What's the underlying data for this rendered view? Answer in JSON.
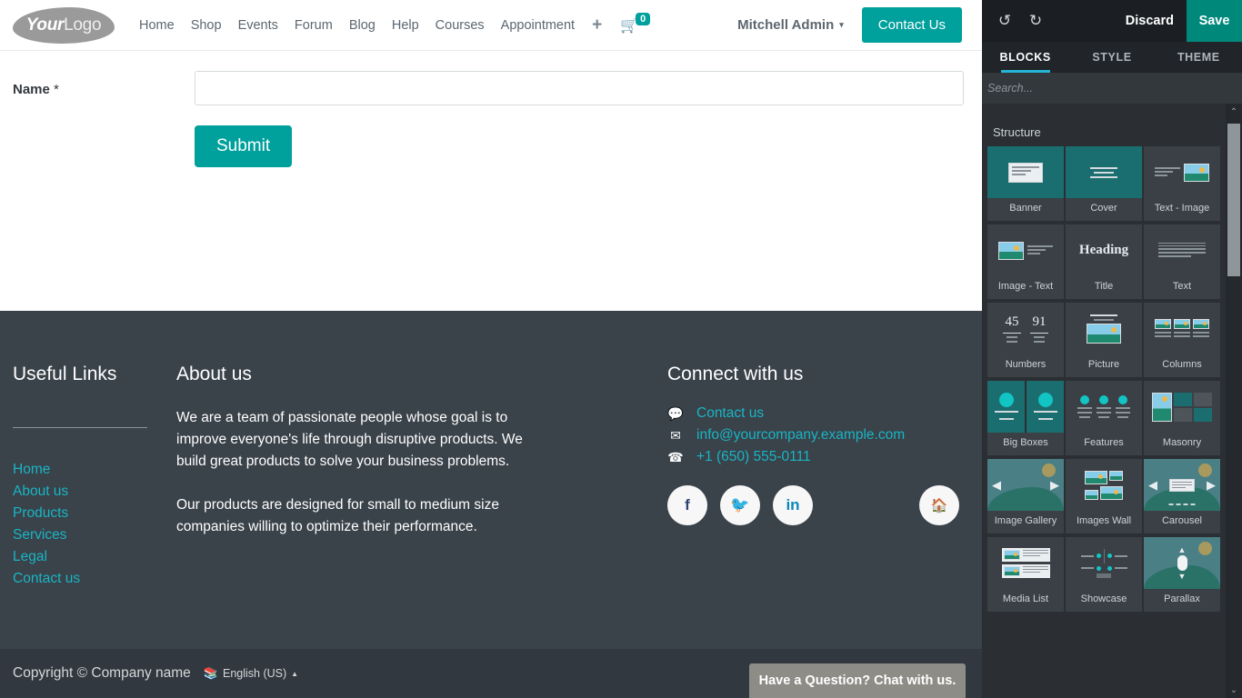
{
  "site": {
    "header": {
      "logo": {
        "bold_part": "Your",
        "light_part": "Logo"
      },
      "nav_items": [
        {
          "label": "Home"
        },
        {
          "label": "Shop"
        },
        {
          "label": "Events"
        },
        {
          "label": "Forum"
        },
        {
          "label": "Blog"
        },
        {
          "label": "Help"
        },
        {
          "label": "Courses"
        },
        {
          "label": "Appointment"
        }
      ],
      "plus_label": "+",
      "cart_icon": "shopping-cart-icon",
      "cart_count": "0",
      "user_name": "Mitchell Admin",
      "user_caret": "▾",
      "contact_button": "Contact Us"
    },
    "form": {
      "name_label": "Name",
      "required_mark": "*",
      "name_value": "",
      "name_placeholder": "",
      "submit_label": "Submit"
    },
    "footer": {
      "links_heading": "Useful Links",
      "links": [
        {
          "label": "Home"
        },
        {
          "label": "About us"
        },
        {
          "label": "Products"
        },
        {
          "label": "Services"
        },
        {
          "label": "Legal"
        },
        {
          "label": "Contact us"
        }
      ],
      "about_heading": "About us",
      "about_p1": "We are a team of passionate people whose goal is to improve everyone's life through disruptive products. We build great products to solve your business problems.",
      "about_p2": "Our products are designed for small to medium size companies willing to optimize their performance.",
      "connect_heading": "Connect with us",
      "connect_items": [
        {
          "icon": "comment-icon",
          "glyph": "💬",
          "label": "Contact us"
        },
        {
          "icon": "envelope-icon",
          "glyph": "✉",
          "label": "info@yourcompany.example.com"
        },
        {
          "icon": "phone-icon",
          "glyph": "☎",
          "label": "+1 (650) 555-0111"
        }
      ],
      "socials": [
        {
          "name": "facebook-icon",
          "glyph": "f"
        },
        {
          "name": "twitter-icon",
          "glyph": "🐦"
        },
        {
          "name": "linkedin-icon",
          "glyph": "in"
        },
        {
          "name": "home-icon",
          "glyph": "🏠"
        }
      ],
      "copyright": "Copyright © Company name",
      "language": "English (US)",
      "language_caret": "▲",
      "language_flag": "📚"
    },
    "chat_widget": {
      "label": "Have a Question? Chat with us."
    }
  },
  "editor": {
    "toolbar": {
      "undo_icon": "undo-icon",
      "undo_glyph": "↺",
      "redo_icon": "redo-icon",
      "redo_glyph": "↻",
      "discard_label": "Discard",
      "save_label": "Save"
    },
    "tabs": [
      {
        "label": "BLOCKS",
        "active": true
      },
      {
        "label": "STYLE",
        "active": false
      },
      {
        "label": "THEME",
        "active": false
      }
    ],
    "search": {
      "value": "",
      "placeholder": "Search..."
    },
    "group_title": "Structure",
    "blocks": [
      {
        "label": "Banner",
        "thumb": "banner"
      },
      {
        "label": "Cover",
        "thumb": "cover"
      },
      {
        "label": "Text - Image",
        "thumb": "text-image"
      },
      {
        "label": "Image - Text",
        "thumb": "image-text"
      },
      {
        "label": "Title",
        "thumb": "title"
      },
      {
        "label": "Text",
        "thumb": "text"
      },
      {
        "label": "Numbers",
        "thumb": "numbers"
      },
      {
        "label": "Picture",
        "thumb": "picture"
      },
      {
        "label": "Columns",
        "thumb": "columns"
      },
      {
        "label": "Big Boxes",
        "thumb": "big-boxes"
      },
      {
        "label": "Features",
        "thumb": "features"
      },
      {
        "label": "Masonry",
        "thumb": "masonry"
      },
      {
        "label": "Image Gallery",
        "thumb": "image-gallery"
      },
      {
        "label": "Images Wall",
        "thumb": "images-wall"
      },
      {
        "label": "Carousel",
        "thumb": "carousel"
      },
      {
        "label": "Media List",
        "thumb": "media-list"
      },
      {
        "label": "Showcase",
        "thumb": "showcase"
      },
      {
        "label": "Parallax",
        "thumb": "parallax"
      }
    ],
    "numbers_thumb": {
      "n1": "45",
      "n2": "91"
    },
    "title_thumb": {
      "text": "Heading"
    },
    "scrollbar": {
      "up_glyph": "⌃",
      "down_glyph": "⌄"
    }
  },
  "colors": {
    "accent_teal": "#00a09d",
    "save_teal": "#00897b",
    "footer_bg": "#3a424a",
    "copybar_bg": "#31383f",
    "link_cyan": "#19b5c4",
    "panel_bg": "#2b2f33",
    "tab_underline": "#23b5d3"
  }
}
